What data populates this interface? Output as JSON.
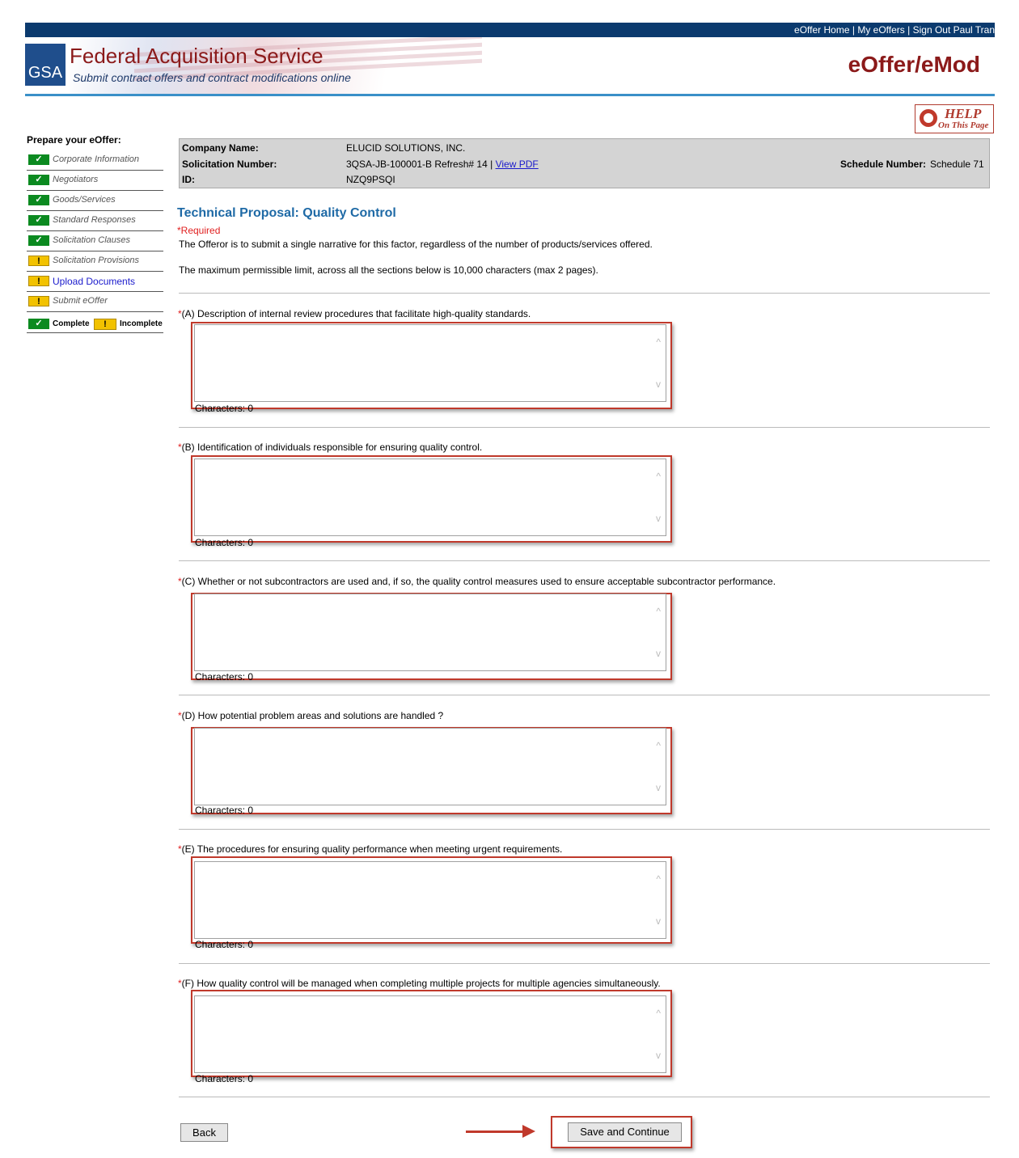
{
  "header": {
    "links": [
      "eOffer Home",
      "My eOffers",
      "Sign Out Paul Tran"
    ],
    "separator": "|",
    "logo_text": "GSA",
    "title": "Federal Acquisition Service",
    "subtitle": "Submit contract offers and contract modifications online",
    "app_name": "eOffer/eMod",
    "help_line1": "HELP",
    "help_line2": "On This Page"
  },
  "sidebar": {
    "heading": "Prepare your eOffer:",
    "items": [
      {
        "label": "Corporate Information",
        "status": "complete"
      },
      {
        "label": "Negotiators",
        "status": "complete"
      },
      {
        "label": "Goods/Services",
        "status": "complete"
      },
      {
        "label": "Standard Responses",
        "status": "complete"
      },
      {
        "label": "Solicitation Clauses",
        "status": "complete"
      },
      {
        "label": "Solicitation Provisions",
        "status": "incomplete"
      },
      {
        "label": "Upload Documents",
        "status": "incomplete"
      },
      {
        "label": "Submit eOffer",
        "status": "incomplete"
      }
    ],
    "legend": {
      "complete": "Complete",
      "incomplete": "Incomplete"
    }
  },
  "info": {
    "company_label": "Company Name:",
    "company_value": "ELUCID SOLUTIONS, INC.",
    "solicitation_label": "Solicitation Number:",
    "solicitation_value": "3QSA-JB-100001-B Refresh# 14 |",
    "view_pdf": "View PDF",
    "id_label": "ID:",
    "id_value": "NZQ9PSQI",
    "schedule_label": "Schedule Number:",
    "schedule_value": "Schedule 71"
  },
  "main": {
    "title": "Technical Proposal: Quality Control",
    "required_note": "*Required",
    "description1": "The Offeror is to submit a single narrative for this factor, regardless of the number of products/services offered.",
    "description2": "The maximum permissible limit, across all the sections below is 10,000 characters (max 2 pages).",
    "questions": [
      {
        "label": "(A) Description of internal review procedures that facilitate high-quality standards.",
        "value": "",
        "chars": "Characters: 0"
      },
      {
        "label": "(B) Identification of individuals responsible for ensuring quality control.",
        "value": "",
        "chars": "Characters: 0"
      },
      {
        "label": "(C) Whether or not subcontractors are used and, if so, the quality control measures used to ensure acceptable subcontractor performance.",
        "value": "",
        "chars": "Characters: 0"
      },
      {
        "label": "(D) How potential problem areas and solutions are handled ?",
        "value": "",
        "chars": "Characters: 0"
      },
      {
        "label": "(E) The procedures for ensuring quality performance when meeting urgent requirements.",
        "value": "",
        "chars": "Characters: 0"
      },
      {
        "label": "(F) How quality control will be managed when completing multiple projects for multiple agencies simultaneously.",
        "value": "",
        "chars": "Characters: 0"
      }
    ],
    "back_button": "Back",
    "save_button": "Save and Continue"
  },
  "colors": {
    "brand_red": "#8b1a1a",
    "nav_blue": "#0b3a6e",
    "accent_blue": "#1f6aa6",
    "complete_green": "#0b8a20",
    "incomplete_yellow": "#f2c200",
    "highlight_red": "#c0392b"
  }
}
